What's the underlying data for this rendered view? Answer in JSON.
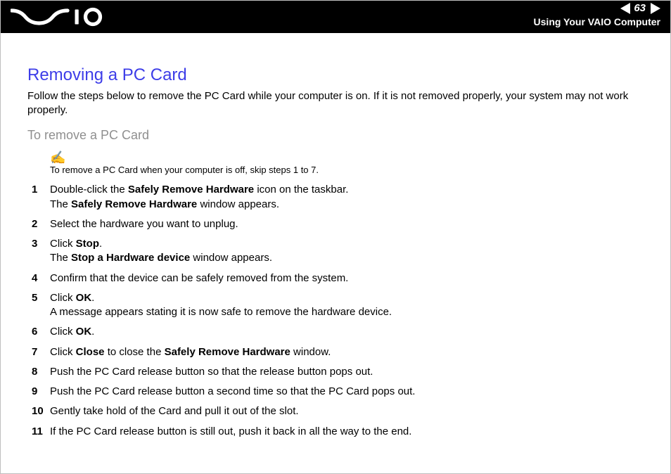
{
  "header": {
    "page_number": "63",
    "section": "Using Your VAIO Computer",
    "logo_alt": "VAIO"
  },
  "content": {
    "title": "Removing a PC Card",
    "intro": "Follow the steps below to remove the PC Card while your computer is on. If it is not removed properly, your system may not work properly.",
    "subheading": "To remove a PC Card",
    "note": "To remove a PC Card when your computer is off, skip steps 1 to 7.",
    "note_icon": "✍",
    "steps": [
      {
        "n": "1",
        "html": "Double-click the <b>Safely Remove Hardware</b> icon on the taskbar.<br>The <b>Safely Remove Hardware</b> window appears."
      },
      {
        "n": "2",
        "html": "Select the hardware you want to unplug."
      },
      {
        "n": "3",
        "html": "Click <b>Stop</b>.<br>The <b>Stop a Hardware device</b> window appears."
      },
      {
        "n": "4",
        "html": "Confirm that the device can be safely removed from the system."
      },
      {
        "n": "5",
        "html": "Click <b>OK</b>.<br>A message appears stating it is now safe to remove the hardware device."
      },
      {
        "n": "6",
        "html": "Click <b>OK</b>."
      },
      {
        "n": "7",
        "html": "Click <b>Close</b> to close the <b>Safely Remove Hardware</b> window."
      },
      {
        "n": "8",
        "html": "Push the PC Card release button so that the release button pops out."
      },
      {
        "n": "9",
        "html": "Push the PC Card release button a second time so that the PC Card pops out."
      },
      {
        "n": "10",
        "html": "Gently take hold of the Card and pull it out of the slot."
      },
      {
        "n": "11",
        "html": "If the PC Card release button is still out, push it back in all the way to the end."
      }
    ]
  }
}
